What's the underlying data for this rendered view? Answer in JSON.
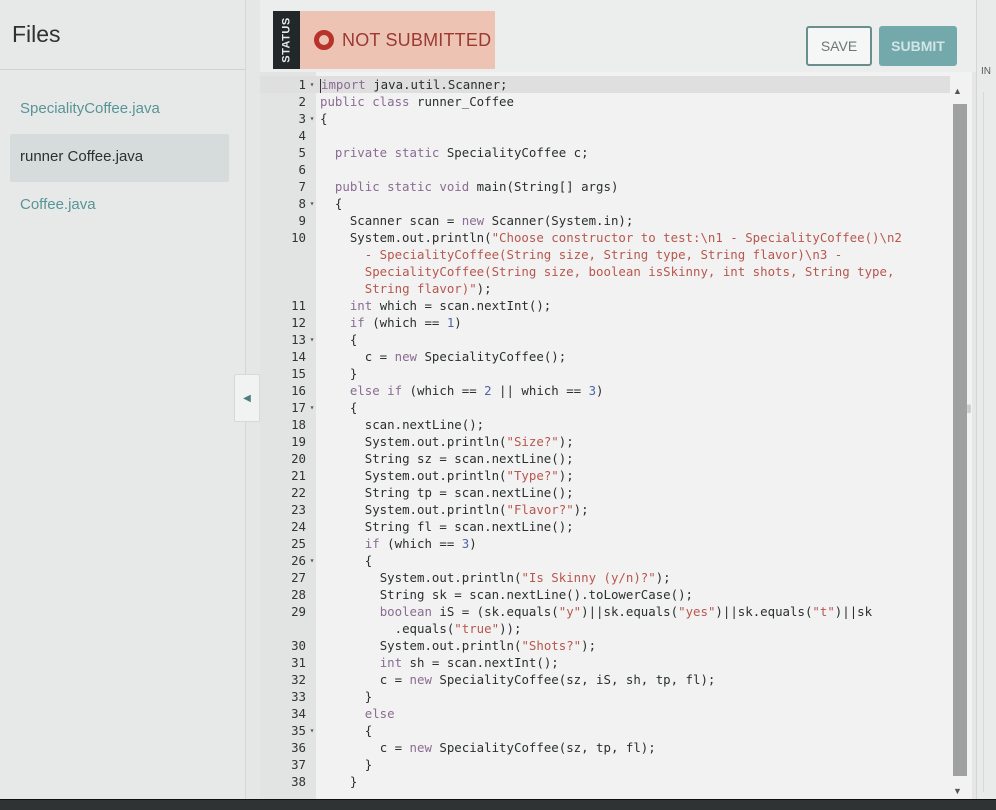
{
  "sidebar": {
    "title": "Files",
    "files": [
      {
        "label": "SpecialityCoffee.java",
        "active": false
      },
      {
        "label": "runner  Coffee.java",
        "active": true
      },
      {
        "label": "Coffee.java",
        "active": false
      }
    ]
  },
  "status": {
    "label": "STATUS",
    "text": "NOT SUBMITTED",
    "icon": "circle-status-icon",
    "color": "#b8332b",
    "background": "#edc3b3"
  },
  "toolbar": {
    "save_label": "SAVE",
    "submit_label": "SUBMIT"
  },
  "right_panel": {
    "label": "IN"
  },
  "colors": {
    "accent": "#74a9ab",
    "link": "#5a9497"
  },
  "editor": {
    "lines": [
      {
        "n": "1",
        "fold": true,
        "active": true,
        "html": "<span class=\"cursor\"></span><span class=\"kw\">import</span> java.util.Scanner;"
      },
      {
        "n": "2",
        "fold": false,
        "html": "<span class=\"kw\">public class</span> runner_Coffee"
      },
      {
        "n": "3",
        "fold": true,
        "html": "{"
      },
      {
        "n": "4",
        "fold": false,
        "html": ""
      },
      {
        "n": "5",
        "fold": false,
        "html": "  <span class=\"kw\">private static</span> SpecialityCoffee c;"
      },
      {
        "n": "6",
        "fold": false,
        "html": ""
      },
      {
        "n": "7",
        "fold": false,
        "html": "  <span class=\"kw\">public static void</span> main(String[] args)"
      },
      {
        "n": "8",
        "fold": true,
        "html": "  {"
      },
      {
        "n": "9",
        "fold": false,
        "html": "    Scanner scan = <span class=\"kw\">new</span> Scanner(System.in);"
      },
      {
        "n": "10",
        "fold": false,
        "html": "    System.out.println(<span class=\"str\">\"Choose constructor to test:\\n1 - SpecialityCoffee()\\n2\n      - SpecialityCoffee(String size, String type, String flavor)\\n3 -\n      SpecialityCoffee(String size, boolean isSkinny, int shots, String type,\n      String flavor)\"</span>);"
      },
      {
        "n": "11",
        "fold": false,
        "html": "    <span class=\"kw\">int</span> which = scan.nextInt();"
      },
      {
        "n": "12",
        "fold": false,
        "html": "    <span class=\"kw\">if</span> (which == <span class=\"num\">1</span>)"
      },
      {
        "n": "13",
        "fold": true,
        "html": "    {"
      },
      {
        "n": "14",
        "fold": false,
        "html": "      c = <span class=\"kw\">new</span> SpecialityCoffee();"
      },
      {
        "n": "15",
        "fold": false,
        "html": "    }"
      },
      {
        "n": "16",
        "fold": false,
        "html": "    <span class=\"kw\">else if</span> (which == <span class=\"num\">2</span> || which == <span class=\"num\">3</span>)"
      },
      {
        "n": "17",
        "fold": true,
        "html": "    {"
      },
      {
        "n": "18",
        "fold": false,
        "html": "      scan.nextLine();"
      },
      {
        "n": "19",
        "fold": false,
        "html": "      System.out.println(<span class=\"str\">\"Size?\"</span>);"
      },
      {
        "n": "20",
        "fold": false,
        "html": "      String sz = scan.nextLine();"
      },
      {
        "n": "21",
        "fold": false,
        "html": "      System.out.println(<span class=\"str\">\"Type?\"</span>);"
      },
      {
        "n": "22",
        "fold": false,
        "html": "      String tp = scan.nextLine();"
      },
      {
        "n": "23",
        "fold": false,
        "html": "      System.out.println(<span class=\"str\">\"Flavor?\"</span>);"
      },
      {
        "n": "24",
        "fold": false,
        "html": "      String fl = scan.nextLine();"
      },
      {
        "n": "25",
        "fold": false,
        "html": "      <span class=\"kw\">if</span> (which == <span class=\"num\">3</span>)"
      },
      {
        "n": "26",
        "fold": true,
        "html": "      {"
      },
      {
        "n": "27",
        "fold": false,
        "html": "        System.out.println(<span class=\"str\">\"Is Skinny (y/n)?\"</span>);"
      },
      {
        "n": "28",
        "fold": false,
        "html": "        String sk = scan.nextLine().toLowerCase();"
      },
      {
        "n": "29",
        "fold": false,
        "html": "        <span class=\"kw\">boolean</span> iS = (sk.equals(<span class=\"str\">\"y\"</span>)||sk.equals(<span class=\"str\">\"yes\"</span>)||sk.equals(<span class=\"str\">\"t\"</span>)||sk\n          .equals(<span class=\"str\">\"true\"</span>));"
      },
      {
        "n": "30",
        "fold": false,
        "html": "        System.out.println(<span class=\"str\">\"Shots?\"</span>);"
      },
      {
        "n": "31",
        "fold": false,
        "html": "        <span class=\"kw\">int</span> sh = scan.nextInt();"
      },
      {
        "n": "32",
        "fold": false,
        "html": "        c = <span class=\"kw\">new</span> SpecialityCoffee(sz, iS, sh, tp, fl);"
      },
      {
        "n": "33",
        "fold": false,
        "html": "      }"
      },
      {
        "n": "34",
        "fold": false,
        "html": "      <span class=\"kw\">else</span>"
      },
      {
        "n": "35",
        "fold": true,
        "html": "      {"
      },
      {
        "n": "36",
        "fold": false,
        "html": "        c = <span class=\"kw\">new</span> SpecialityCoffee(sz, tp, fl);"
      },
      {
        "n": "37",
        "fold": false,
        "html": "      }"
      },
      {
        "n": "38",
        "fold": false,
        "html": "    }"
      }
    ]
  }
}
